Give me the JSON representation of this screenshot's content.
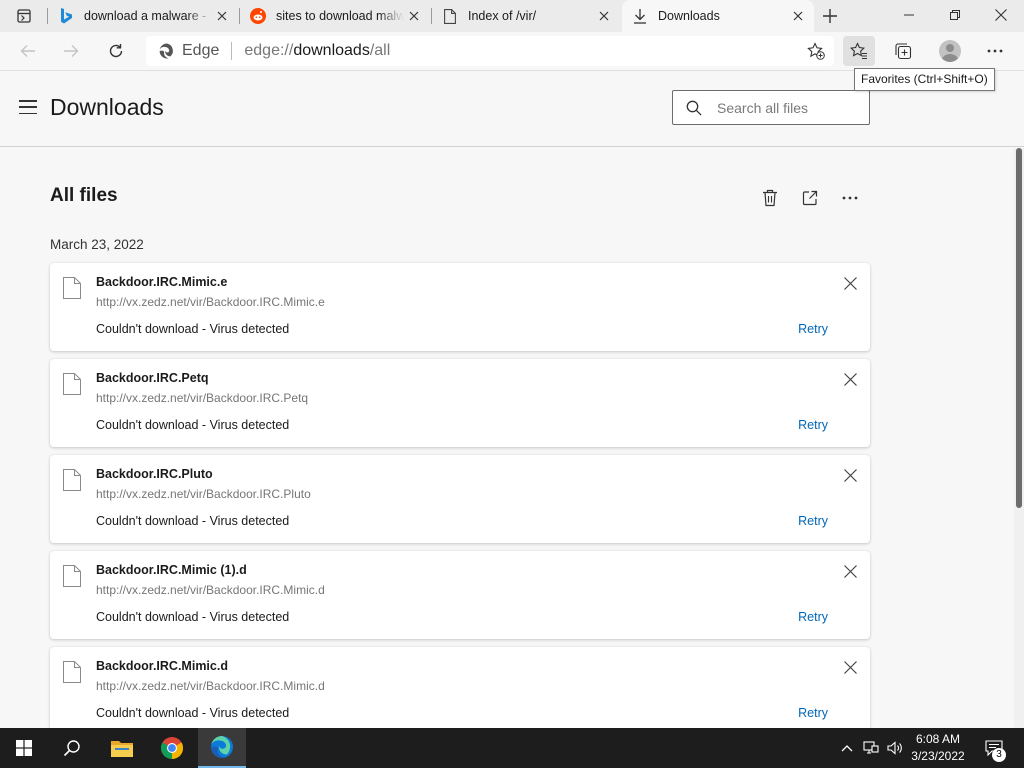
{
  "browser": {
    "tabs": [
      {
        "title": "download a malware - S",
        "favicon": "bing-icon",
        "active": false
      },
      {
        "title": "sites to download malw",
        "favicon": "reddit-icon",
        "active": false
      },
      {
        "title": "Index of /vir/",
        "favicon": "page-icon",
        "active": false
      },
      {
        "title": "Downloads",
        "favicon": "download-icon",
        "active": true
      }
    ],
    "address": {
      "label": "Edge",
      "url_prefix": "edge://",
      "url_path": "downloads",
      "url_suffix": "/all"
    },
    "tooltip": "Favorites (Ctrl+Shift+O)"
  },
  "page": {
    "title": "Downloads",
    "search_placeholder": "Search all files",
    "section_title": "All files",
    "date_group": "March 23, 2022",
    "items": [
      {
        "name": "Backdoor.IRC.Mimic.e",
        "url": "http://vx.zedz.net/vir/Backdoor.IRC.Mimic.e",
        "status": "Couldn't download - Virus detected",
        "action": "Retry"
      },
      {
        "name": "Backdoor.IRC.Petq",
        "url": "http://vx.zedz.net/vir/Backdoor.IRC.Petq",
        "status": "Couldn't download - Virus detected",
        "action": "Retry"
      },
      {
        "name": "Backdoor.IRC.Pluto",
        "url": "http://vx.zedz.net/vir/Backdoor.IRC.Pluto",
        "status": "Couldn't download - Virus detected",
        "action": "Retry"
      },
      {
        "name": "Backdoor.IRC.Mimic (1).d",
        "url": "http://vx.zedz.net/vir/Backdoor.IRC.Mimic.d",
        "status": "Couldn't download - Virus detected",
        "action": "Retry"
      },
      {
        "name": "Backdoor.IRC.Mimic.d",
        "url": "http://vx.zedz.net/vir/Backdoor.IRC.Mimic.d",
        "status": "Couldn't download - Virus detected",
        "action": "Retry"
      }
    ]
  },
  "taskbar": {
    "time": "6:08 AM",
    "date": "3/23/2022",
    "notification_count": "3",
    "pinned": [
      "file-explorer-icon",
      "chrome-icon",
      "edge-icon"
    ]
  },
  "colors": {
    "accent": "#0067b8",
    "taskbar": "#1d1d1d"
  }
}
